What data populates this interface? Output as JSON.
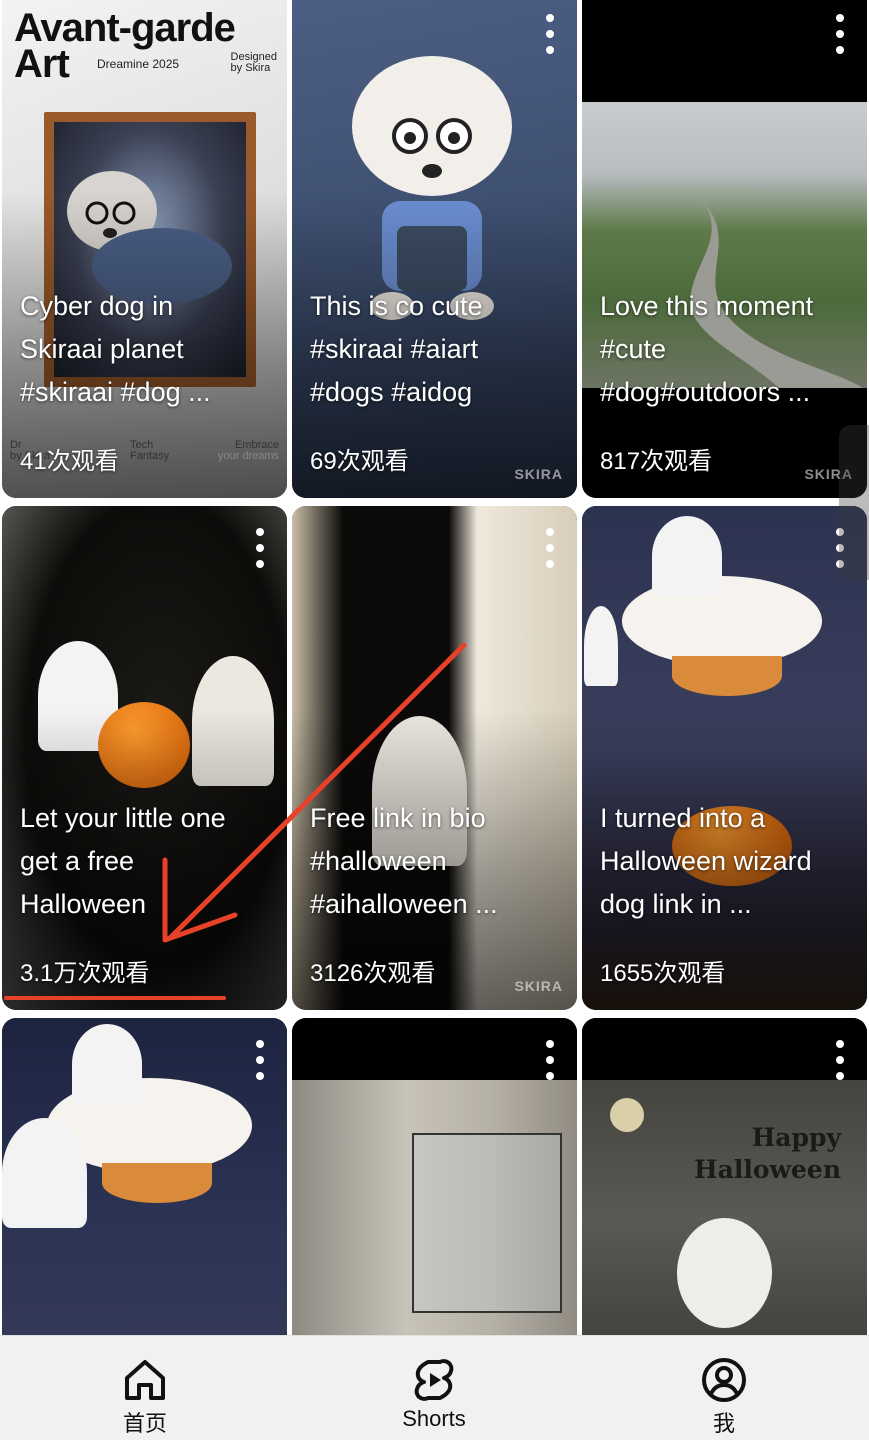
{
  "cards": [
    {
      "poster": {
        "title_line1": "Avant-garde",
        "title_line2": "Art",
        "subtitle": "Dreamine 2025",
        "credit_line1": "Designed",
        "credit_line2": "by Skira",
        "footer_left": "Dr",
        "footer_left2": "by Skira",
        "footer_mid1": "Tech",
        "footer_mid2": "Fantasy",
        "footer_right1": "Embrace",
        "footer_right2": "your dreams"
      },
      "title_lines": [
        "Cyber dog in",
        "Skiraai planet",
        "#skiraai #dog ..."
      ],
      "views": "41次观看"
    },
    {
      "title_lines": [
        "This is co cute",
        "#skiraai #aiart",
        "#dogs #aidog"
      ],
      "views": "69次观看",
      "watermark": "SKIRA"
    },
    {
      "title_lines": [
        "Love this moment",
        "#cute",
        "#dog#outdoors ..."
      ],
      "views": "817次观看",
      "watermark": "SKIRA"
    },
    {
      "title_lines": [
        "Let your little one",
        "get a free",
        "Halloween"
      ],
      "views": "3.1万次观看"
    },
    {
      "title_lines": [
        "Free link in bio",
        "#halloween",
        "#aihalloween ..."
      ],
      "views": "3126次观看",
      "watermark": "SKIRA"
    },
    {
      "title_lines": [
        "I turned into a",
        "Halloween wizard",
        "dog link in ..."
      ],
      "views": "1655次观看"
    },
    {
      "title_lines": [],
      "views": ""
    },
    {
      "title_lines": [],
      "views": ""
    },
    {
      "title_lines": [],
      "views": "",
      "overlay_text_1": "Happy",
      "overlay_text_2": "Halloween"
    }
  ],
  "nav": {
    "home_label": "首页",
    "shorts_label": "Shorts",
    "me_label": "我"
  },
  "annotation": {
    "color": "#e8412a"
  }
}
